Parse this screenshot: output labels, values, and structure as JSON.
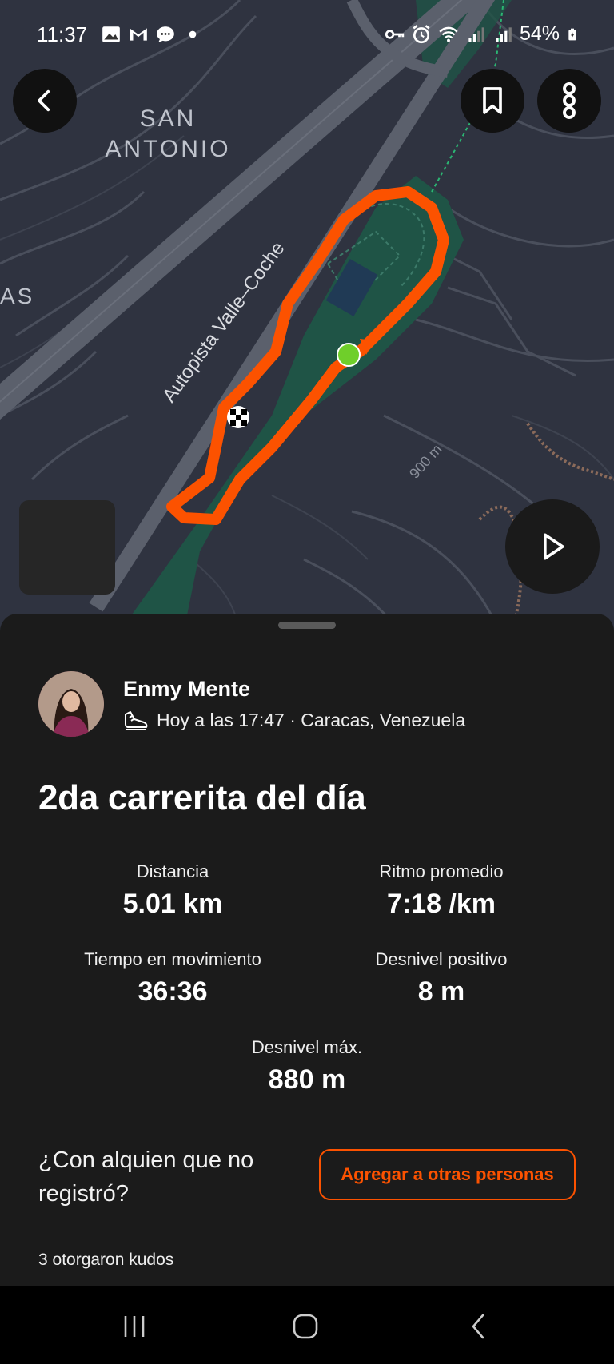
{
  "status_bar": {
    "time": "11:37",
    "battery": "54%",
    "icons_left": [
      "gallery-icon",
      "gmail-icon",
      "chat-icon",
      "dot-icon"
    ],
    "icons_right": [
      "key-icon",
      "alarm-icon",
      "wifi-icon",
      "signal-icon",
      "signal-icon",
      "battery-icon"
    ]
  },
  "map": {
    "labels": {
      "district": "SAN\nANTONIO",
      "district_line1": "SAN",
      "district_line2": "ANTONIO",
      "highway": "Autopista Valle–Coche",
      "elevation": "900 m",
      "edge_text": "AS"
    },
    "route_color": "#fc5200",
    "start_color": "#6fcf2a"
  },
  "athlete": {
    "name": "Enmy Mente",
    "meta": "Hoy a las 17:47 · Caracas, Venezuela"
  },
  "activity": {
    "title": "2da carrerita del día"
  },
  "stats": {
    "distance": {
      "label": "Distancia",
      "value": "5.01 km"
    },
    "pace": {
      "label": "Ritmo promedio",
      "value": "7:18 /km"
    },
    "moving_time": {
      "label": "Tiempo en movimiento",
      "value": "36:36"
    },
    "elevation_gain": {
      "label": "Desnivel positivo",
      "value": "8 m"
    },
    "max_elevation": {
      "label": "Desnivel máx.",
      "value": "880 m"
    }
  },
  "with_others": {
    "question": "¿Con alquien que no registró?",
    "button_label": "Agregar a otras personas"
  },
  "kudos": {
    "text": "3 otorgaron kudos"
  },
  "colors": {
    "accent": "#fc5200",
    "background": "#1b1b1b",
    "map_bg": "#2f3340",
    "park": "#1f5446"
  }
}
